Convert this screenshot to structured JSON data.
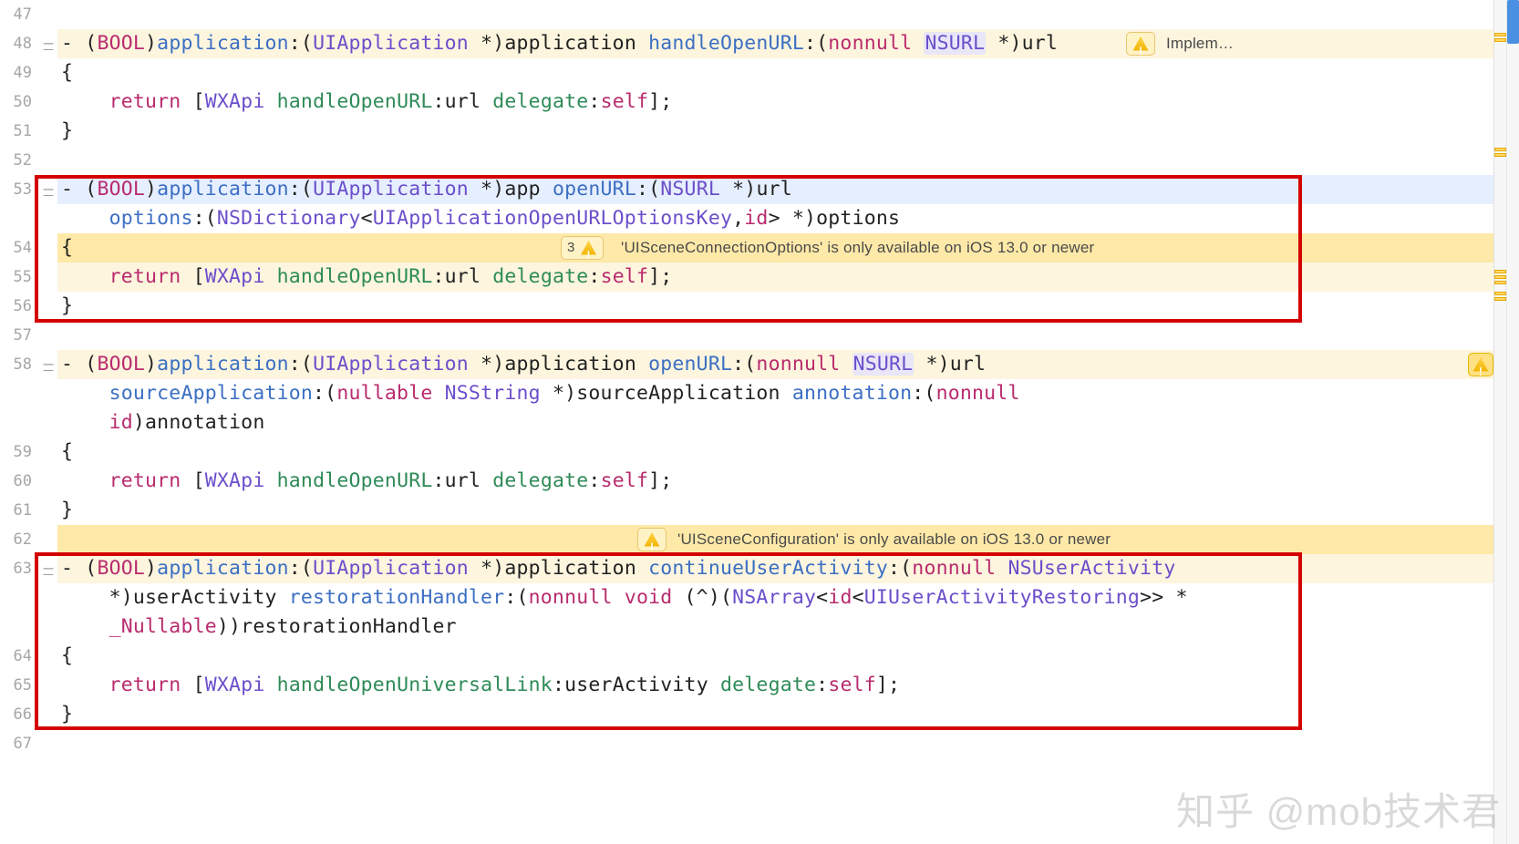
{
  "gutter": {
    "start": 47,
    "lines": [
      47,
      48,
      49,
      50,
      51,
      52,
      53,
      null,
      54,
      55,
      56,
      57,
      58,
      null,
      null,
      59,
      60,
      61,
      62,
      63,
      null,
      null,
      64,
      65,
      66,
      67
    ]
  },
  "fold_rows": [
    48,
    53,
    58,
    63
  ],
  "code": {
    "l47": "",
    "l48": {
      "tokens": [
        {
          "t": "- (",
          "c": "plain"
        },
        {
          "t": "BOOL",
          "c": "kw"
        },
        {
          "t": ")",
          "c": "plain"
        },
        {
          "t": "application",
          "c": "fn"
        },
        {
          "t": ":(",
          "c": "plain"
        },
        {
          "t": "UIApplication",
          "c": "type"
        },
        {
          "t": " *)",
          "c": "plain"
        },
        {
          "t": "application ",
          "c": "plain"
        },
        {
          "t": "handleOpenURL",
          "c": "fn"
        },
        {
          "t": ":(",
          "c": "plain"
        },
        {
          "t": "nonnull",
          "c": "kw"
        },
        {
          "t": " ",
          "c": "plain"
        },
        {
          "t": "NSURL",
          "c": "hl-type"
        },
        {
          "t": " *)",
          "c": "plain"
        },
        {
          "t": "url",
          "c": "plain"
        }
      ]
    },
    "l49": {
      "tokens": [
        {
          "t": "{",
          "c": "plain"
        }
      ]
    },
    "l50": {
      "indent": "    ",
      "tokens": [
        {
          "t": "return",
          "c": "kw"
        },
        {
          "t": " [",
          "c": "plain"
        },
        {
          "t": "WXApi",
          "c": "type"
        },
        {
          "t": " ",
          "c": "plain"
        },
        {
          "t": "handleOpenURL",
          "c": "sel"
        },
        {
          "t": ":url ",
          "c": "plain"
        },
        {
          "t": "delegate",
          "c": "sel"
        },
        {
          "t": ":",
          "c": "plain"
        },
        {
          "t": "self",
          "c": "self"
        },
        {
          "t": "];",
          "c": "plain"
        }
      ]
    },
    "l51": {
      "tokens": [
        {
          "t": "}",
          "c": "plain"
        }
      ]
    },
    "l52": "",
    "l53a": {
      "tokens": [
        {
          "t": "- (",
          "c": "plain"
        },
        {
          "t": "BOOL",
          "c": "kw"
        },
        {
          "t": ")",
          "c": "plain"
        },
        {
          "t": "application",
          "c": "fn"
        },
        {
          "t": ":(",
          "c": "plain"
        },
        {
          "t": "UIApplication",
          "c": "type"
        },
        {
          "t": " *)",
          "c": "plain"
        },
        {
          "t": "app ",
          "c": "plain"
        },
        {
          "t": "openURL",
          "c": "fn"
        },
        {
          "t": ":(",
          "c": "plain"
        },
        {
          "t": "NSURL",
          "c": "type"
        },
        {
          "t": " *)",
          "c": "plain"
        },
        {
          "t": "url",
          "c": "plain"
        }
      ]
    },
    "l53b": {
      "indent": "    ",
      "tokens": [
        {
          "t": "options",
          "c": "fn"
        },
        {
          "t": ":(",
          "c": "plain"
        },
        {
          "t": "NSDictionary",
          "c": "type"
        },
        {
          "t": "<",
          "c": "plain"
        },
        {
          "t": "UIApplicationOpenURLOptionsKey",
          "c": "type"
        },
        {
          "t": ",",
          "c": "plain"
        },
        {
          "t": "id",
          "c": "kw2"
        },
        {
          "t": "> *)",
          "c": "plain"
        },
        {
          "t": "options",
          "c": "plain"
        }
      ]
    },
    "l54": {
      "tokens": [
        {
          "t": "{",
          "c": "plain"
        }
      ]
    },
    "l55": {
      "indent": "    ",
      "tokens": [
        {
          "t": "return",
          "c": "kw"
        },
        {
          "t": " [",
          "c": "plain"
        },
        {
          "t": "WXApi",
          "c": "type"
        },
        {
          "t": " ",
          "c": "plain"
        },
        {
          "t": "handleOpenURL",
          "c": "sel"
        },
        {
          "t": ":url ",
          "c": "plain"
        },
        {
          "t": "delegate",
          "c": "sel"
        },
        {
          "t": ":",
          "c": "plain"
        },
        {
          "t": "self",
          "c": "self"
        },
        {
          "t": "];",
          "c": "plain"
        }
      ]
    },
    "l56": {
      "tokens": [
        {
          "t": "}",
          "c": "plain"
        }
      ]
    },
    "l57": "",
    "l58a": {
      "tokens": [
        {
          "t": "- (",
          "c": "plain"
        },
        {
          "t": "BOOL",
          "c": "kw"
        },
        {
          "t": ")",
          "c": "plain"
        },
        {
          "t": "application",
          "c": "fn"
        },
        {
          "t": ":(",
          "c": "plain"
        },
        {
          "t": "UIApplication",
          "c": "type"
        },
        {
          "t": " *)",
          "c": "plain"
        },
        {
          "t": "application ",
          "c": "plain"
        },
        {
          "t": "openURL",
          "c": "fn"
        },
        {
          "t": ":(",
          "c": "plain"
        },
        {
          "t": "nonnull",
          "c": "kw"
        },
        {
          "t": " ",
          "c": "plain"
        },
        {
          "t": "NSURL",
          "c": "hl-type"
        },
        {
          "t": " *)",
          "c": "plain"
        },
        {
          "t": "url",
          "c": "plain"
        }
      ]
    },
    "l58b": {
      "indent": "    ",
      "tokens": [
        {
          "t": "sourceApplication",
          "c": "fn"
        },
        {
          "t": ":(",
          "c": "plain"
        },
        {
          "t": "nullable",
          "c": "kw"
        },
        {
          "t": " ",
          "c": "plain"
        },
        {
          "t": "NSString",
          "c": "type"
        },
        {
          "t": " *)",
          "c": "plain"
        },
        {
          "t": "sourceApplication ",
          "c": "plain"
        },
        {
          "t": "annotation",
          "c": "fn"
        },
        {
          "t": ":(",
          "c": "plain"
        },
        {
          "t": "nonnull",
          "c": "kw"
        }
      ]
    },
    "l58c": {
      "indent": "    ",
      "tokens": [
        {
          "t": "id",
          "c": "kw2"
        },
        {
          "t": ")",
          "c": "plain"
        },
        {
          "t": "annotation",
          "c": "plain"
        }
      ]
    },
    "l59": {
      "tokens": [
        {
          "t": "{",
          "c": "plain"
        }
      ]
    },
    "l60": {
      "indent": "    ",
      "tokens": [
        {
          "t": "return",
          "c": "kw"
        },
        {
          "t": " [",
          "c": "plain"
        },
        {
          "t": "WXApi",
          "c": "type"
        },
        {
          "t": " ",
          "c": "plain"
        },
        {
          "t": "handleOpenURL",
          "c": "sel"
        },
        {
          "t": ":url ",
          "c": "plain"
        },
        {
          "t": "delegate",
          "c": "sel"
        },
        {
          "t": ":",
          "c": "plain"
        },
        {
          "t": "self",
          "c": "self"
        },
        {
          "t": "];",
          "c": "plain"
        }
      ]
    },
    "l61": {
      "tokens": [
        {
          "t": "}",
          "c": "plain"
        }
      ]
    },
    "l62": "",
    "l63a": {
      "tokens": [
        {
          "t": "- (",
          "c": "plain"
        },
        {
          "t": "BOOL",
          "c": "kw"
        },
        {
          "t": ")",
          "c": "plain"
        },
        {
          "t": "application",
          "c": "fn"
        },
        {
          "t": ":(",
          "c": "plain"
        },
        {
          "t": "UIApplication",
          "c": "type"
        },
        {
          "t": " *)",
          "c": "plain"
        },
        {
          "t": "application ",
          "c": "plain"
        },
        {
          "t": "continueUserActivity",
          "c": "fn"
        },
        {
          "t": ":(",
          "c": "plain"
        },
        {
          "t": "nonnull",
          "c": "kw"
        },
        {
          "t": " ",
          "c": "plain"
        },
        {
          "t": "NSUserActivity",
          "c": "type"
        }
      ]
    },
    "l63b": {
      "indent": "    ",
      "tokens": [
        {
          "t": "*)",
          "c": "plain"
        },
        {
          "t": "userActivity ",
          "c": "plain"
        },
        {
          "t": "restorationHandler",
          "c": "fn"
        },
        {
          "t": ":(",
          "c": "plain"
        },
        {
          "t": "nonnull",
          "c": "kw"
        },
        {
          "t": " ",
          "c": "plain"
        },
        {
          "t": "void",
          "c": "kw"
        },
        {
          "t": " (^)(",
          "c": "plain"
        },
        {
          "t": "NSArray",
          "c": "type"
        },
        {
          "t": "<",
          "c": "plain"
        },
        {
          "t": "id",
          "c": "kw2"
        },
        {
          "t": "<",
          "c": "plain"
        },
        {
          "t": "UIUserActivityRestoring",
          "c": "type"
        },
        {
          "t": ">> *",
          "c": "plain"
        }
      ]
    },
    "l63c": {
      "indent": "    ",
      "tokens": [
        {
          "t": "_Nullable",
          "c": "kw2"
        },
        {
          "t": "))",
          "c": "plain"
        },
        {
          "t": "restorationHandler",
          "c": "plain"
        }
      ]
    },
    "l64": {
      "tokens": [
        {
          "t": "{",
          "c": "plain"
        }
      ]
    },
    "l65": {
      "indent": "    ",
      "tokens": [
        {
          "t": "return",
          "c": "kw"
        },
        {
          "t": " [",
          "c": "plain"
        },
        {
          "t": "WXApi",
          "c": "type"
        },
        {
          "t": " ",
          "c": "plain"
        },
        {
          "t": "handleOpenUniversalLink",
          "c": "sel"
        },
        {
          "t": ":userActivity ",
          "c": "plain"
        },
        {
          "t": "delegate",
          "c": "sel"
        },
        {
          "t": ":",
          "c": "plain"
        },
        {
          "t": "self",
          "c": "self"
        },
        {
          "t": "];",
          "c": "plain"
        }
      ]
    },
    "l66": {
      "tokens": [
        {
          "t": "}",
          "c": "plain"
        }
      ]
    },
    "l67": ""
  },
  "line_bg": {
    "l48": "hl-highlight-bg",
    "l53a": "hl-selected-bg",
    "l54": "hl-yellow-full",
    "l55": "hl-highlight-bg",
    "l58a": "hl-highlight-bg",
    "l62": "hl-yellow-full",
    "l63a": "hl-highlight-bg"
  },
  "warnings": {
    "w48": {
      "label": "Implem…"
    },
    "w54": {
      "count": "3",
      "text": "'UISceneConnectionOptions' is only available on iOS 13.0 or newer"
    },
    "w62": {
      "text": "'UISceneConfiguration' is only available on iOS 13.0 or newer"
    }
  },
  "watermark": "知乎 @mob技术君",
  "minimap_marks": [
    36,
    42,
    162,
    168,
    296,
    302,
    308,
    320,
    326
  ]
}
